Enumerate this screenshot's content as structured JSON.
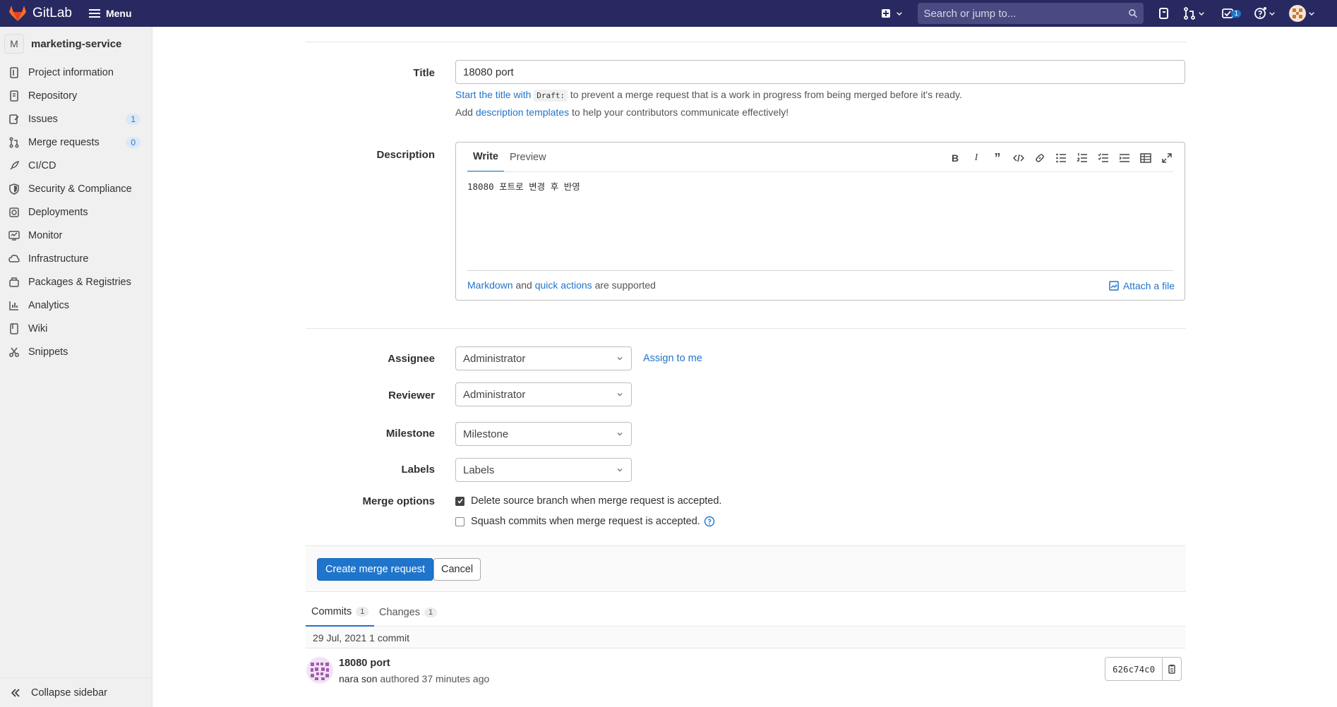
{
  "navbar": {
    "brand": "GitLab",
    "menu_label": "Menu",
    "search_placeholder": "Search or jump to...",
    "todos_count": "1"
  },
  "sidebar": {
    "project_initial": "M",
    "project_name": "marketing-service",
    "items": [
      {
        "label": "Project information",
        "icon": "info-icon"
      },
      {
        "label": "Repository",
        "icon": "repository-icon"
      },
      {
        "label": "Issues",
        "icon": "issues-icon",
        "count": "1"
      },
      {
        "label": "Merge requests",
        "icon": "merge-request-icon",
        "count": "0"
      },
      {
        "label": "CI/CD",
        "icon": "rocket-icon"
      },
      {
        "label": "Security & Compliance",
        "icon": "shield-icon"
      },
      {
        "label": "Deployments",
        "icon": "deployments-icon"
      },
      {
        "label": "Monitor",
        "icon": "monitor-icon"
      },
      {
        "label": "Infrastructure",
        "icon": "cloud-icon"
      },
      {
        "label": "Packages & Registries",
        "icon": "package-icon"
      },
      {
        "label": "Analytics",
        "icon": "chart-icon"
      },
      {
        "label": "Wiki",
        "icon": "book-icon"
      },
      {
        "label": "Snippets",
        "icon": "scissors-icon"
      }
    ],
    "collapse_label": "Collapse sidebar"
  },
  "form": {
    "title_label": "Title",
    "title_value": "18080 port",
    "title_help_link": "Start the title with",
    "title_help_code": "Draft:",
    "title_help_rest": "to prevent a merge request that is a work in progress from being merged before it's ready.",
    "templates_pre": "Add",
    "templates_link": "description templates",
    "templates_post": "to help your contributors communicate effectively!",
    "description_label": "Description",
    "tab_write": "Write",
    "tab_preview": "Preview",
    "description_value": "18080 포트로 변경 후 반영",
    "markdown_link": "Markdown",
    "and_text": "and",
    "quick_actions_link": "quick actions",
    "supported_text": "are supported",
    "attach_label": "Attach a file",
    "assignee_label": "Assignee",
    "assignee_value": "Administrator",
    "assign_to_me": "Assign to me",
    "reviewer_label": "Reviewer",
    "reviewer_value": "Administrator",
    "milestone_label": "Milestone",
    "milestone_value": "Milestone",
    "labels_label": "Labels",
    "labels_value": "Labels",
    "merge_options_label": "Merge options",
    "delete_branch": "Delete source branch when merge request is accepted.",
    "delete_branch_checked": true,
    "squash": "Squash commits when merge request is accepted.",
    "squash_checked": false,
    "create_button": "Create merge request",
    "cancel_button": "Cancel"
  },
  "commits": {
    "tab_commits": "Commits",
    "commits_count": "1",
    "tab_changes": "Changes",
    "changes_count": "1",
    "day_header": "29 Jul, 2021 1 commit",
    "items": [
      {
        "title": "18080 port",
        "author": "nara son",
        "authored": "authored 37 minutes ago",
        "sha": "626c74c0"
      }
    ]
  }
}
